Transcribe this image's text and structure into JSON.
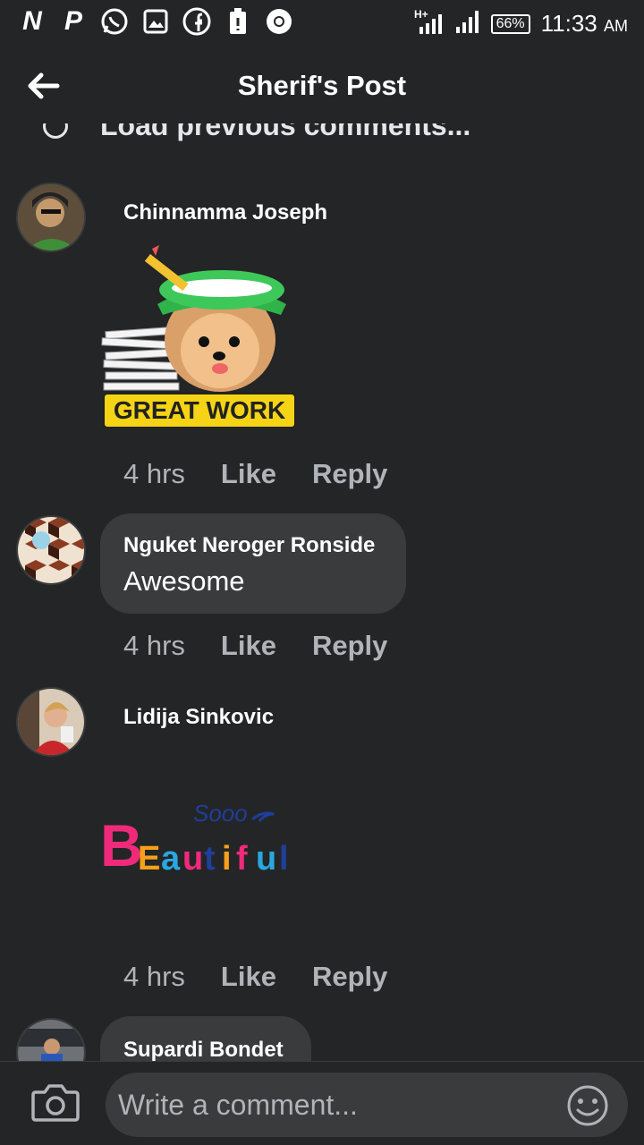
{
  "status_bar": {
    "battery": "66%",
    "time": "11:33",
    "ampm": "AM",
    "network": "H+",
    "left_icons": [
      "netflix-n-icon",
      "pandora-p-icon",
      "whatsapp-icon",
      "gallery-icon",
      "facebook-icon",
      "battery-saver-icon",
      "chrome-icon"
    ]
  },
  "header": {
    "title": "Sherif's Post"
  },
  "load_previous": "Load previous comments...",
  "comments": [
    {
      "name": "Chinnamma Joseph",
      "sticker_text": "GREAT WORK",
      "time": "4 hrs",
      "like": "Like",
      "reply": "Reply"
    },
    {
      "name": "Nguket Neroger Ronside",
      "text": "Awesome",
      "time": "4 hrs",
      "like": "Like",
      "reply": "Reply"
    },
    {
      "name": "Lidija Sinkovic",
      "sticker_text_small": "Sooo",
      "sticker_text_big": "BEautiful",
      "time": "4 hrs",
      "like": "Like",
      "reply": "Reply"
    },
    {
      "name": "Supardi Bondet"
    }
  ],
  "composer": {
    "placeholder": "Write a comment..."
  },
  "colors": {
    "background": "#242526",
    "bubble": "#3a3b3c",
    "secondary_text": "#b0b3b8"
  }
}
